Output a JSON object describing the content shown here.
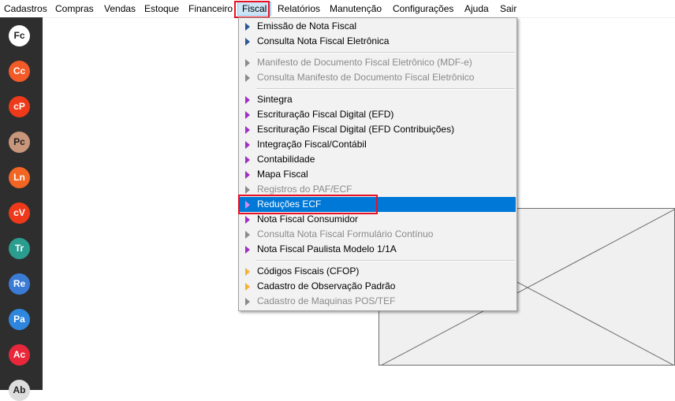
{
  "menubar": {
    "items": [
      {
        "label": "Cadastros"
      },
      {
        "label": "Compras"
      },
      {
        "label": "Vendas"
      },
      {
        "label": "Estoque"
      },
      {
        "label": "Financeiro"
      },
      {
        "label": "Fiscal"
      },
      {
        "label": "Relatórios"
      },
      {
        "label": "Manutenção"
      },
      {
        "label": "Configurações"
      },
      {
        "label": "Ajuda"
      },
      {
        "label": "Sair"
      }
    ]
  },
  "sidebar": {
    "shortcuts": [
      {
        "label": "Fc",
        "color": "#ffffff",
        "text": "#222222"
      },
      {
        "label": "Cc",
        "color": "#f25a28",
        "text": "#ffffff"
      },
      {
        "label": "cP",
        "color": "#ee3a1b",
        "text": "#ffffff"
      },
      {
        "label": "Pc",
        "color": "#c8967a",
        "text": "#222222"
      },
      {
        "label": "Ln",
        "color": "#f26522",
        "text": "#ffffff"
      },
      {
        "label": "cV",
        "color": "#ee3a1b",
        "text": "#ffffff"
      },
      {
        "label": "Tr",
        "color": "#2a9d8f",
        "text": "#ffffff"
      },
      {
        "label": "Re",
        "color": "#3a7bd5",
        "text": "#ffffff"
      },
      {
        "label": "Pa",
        "color": "#2e86de",
        "text": "#ffffff"
      },
      {
        "label": "Ac",
        "color": "#e8283a",
        "text": "#ffffff"
      },
      {
        "label": "Ab",
        "color": "#dddddd",
        "text": "#222222"
      }
    ]
  },
  "fiscal_menu": {
    "group1": [
      {
        "label": "Emissão de Nota Fiscal",
        "state": "enabled"
      },
      {
        "label": "Consulta Nota Fiscal Eletrônica",
        "state": "enabled"
      }
    ],
    "group2": [
      {
        "label": "Manifesto de Documento Fiscal Eletrônico (MDF-e)",
        "state": "disabled"
      },
      {
        "label": "Consulta Manifesto de Documento Fiscal Eletrônico",
        "state": "disabled"
      }
    ],
    "group3": [
      {
        "label": "Sintegra",
        "state": "enabled"
      },
      {
        "label": "Escrituração Fiscal Digital (EFD)",
        "state": "enabled"
      },
      {
        "label": "Escrituração Fiscal Digital (EFD Contribuições)",
        "state": "enabled"
      },
      {
        "label": "Integração Fiscal/Contábil",
        "state": "enabled"
      },
      {
        "label": "Contabilidade",
        "state": "enabled"
      },
      {
        "label": "Mapa Fiscal",
        "state": "enabled"
      },
      {
        "label": "Registros do PAF/ECF",
        "state": "disabled"
      },
      {
        "label": "Reduções ECF",
        "state": "selected"
      },
      {
        "label": "Nota Fiscal Consumidor",
        "state": "enabled"
      },
      {
        "label": "Consulta Nota Fiscal Formulário Contínuo",
        "state": "disabled"
      },
      {
        "label": "Nota Fiscal Paulista Modelo 1/1A",
        "state": "enabled"
      }
    ],
    "group4": [
      {
        "label": "Códigos Fiscais (CFOP)",
        "state": "enabled"
      },
      {
        "label": "Cadastro de Observação Padrão",
        "state": "enabled"
      },
      {
        "label": "Cadastro de Maquinas POS/TEF",
        "state": "disabled"
      }
    ]
  },
  "colors": {
    "selection": "#0078d7",
    "highlight_box": "#e81123",
    "sidebar_bg": "#2e2e2e"
  }
}
